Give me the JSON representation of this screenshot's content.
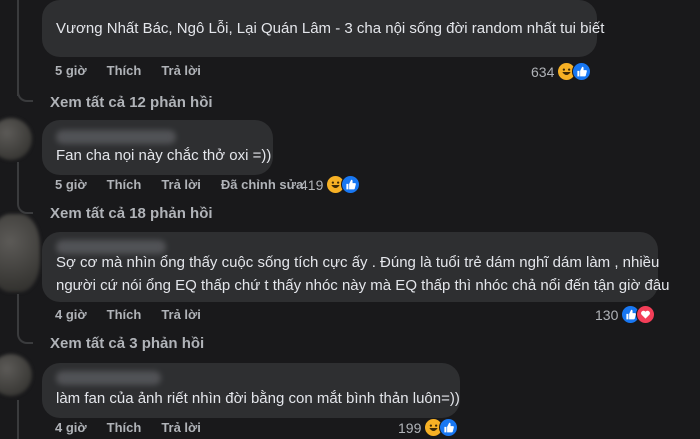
{
  "comments": [
    {
      "text": "Vương Nhất Bác, Ngô Lỗi, Lại Quán Lâm - 3 cha nội sống đời random nhất tui biết",
      "time": "5 giờ",
      "like_label": "Thích",
      "reply_label": "Trả lời",
      "edited_label": "",
      "reaction_count": "634",
      "reaction_icons": [
        "haha-icon",
        "like-icon"
      ],
      "view_replies": "Xem tất cả 12 phản hồi"
    },
    {
      "text": "Fan cha nọi này chắc thở oxi =))",
      "time": "5 giờ",
      "like_label": "Thích",
      "reply_label": "Trả lời",
      "edited_label": "Đã chỉnh sửa",
      "reaction_count": "419",
      "reaction_icons": [
        "haha-icon",
        "like-icon"
      ],
      "view_replies": "Xem tất cả 18 phản hồi"
    },
    {
      "text_line1": "Sợ cơ mà nhìn ổng thấy cuộc sống tích cực ấy . Đúng là tuổi trẻ dám nghĩ dám làm , nhiều",
      "text_line2": "người cứ nói ổng EQ thấp chứ t thấy nhóc này mà EQ thấp thì nhóc chả nổi đến tận giờ đâu",
      "time": "4 giờ",
      "like_label": "Thích",
      "reply_label": "Trả lời",
      "reaction_count": "130",
      "reaction_icons": [
        "like-icon",
        "love-icon"
      ],
      "view_replies": "Xem tất cả 3 phản hồi"
    },
    {
      "text": "làm fan của ảnh riết nhìn đời bằng con mắt bình thản luôn=))",
      "time": "4 giờ",
      "like_label": "Thích",
      "reply_label": "Trả lời",
      "reaction_count": "199",
      "reaction_icons": [
        "haha-icon",
        "like-icon"
      ]
    }
  ],
  "colors": {
    "background": "#19191b",
    "bubble": "#2e2f31",
    "text": "#e4e6eb",
    "meta": "#b0b3b8",
    "like": "#1877f2",
    "haha": "#f7b125",
    "love": "#f33e58"
  }
}
